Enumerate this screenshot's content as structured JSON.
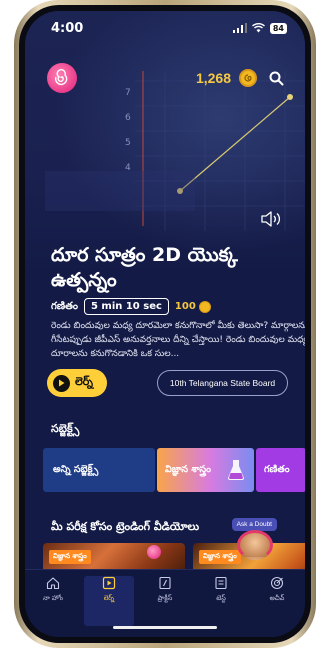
{
  "status_bar": {
    "time": "4:00",
    "battery": "84"
  },
  "header": {
    "coins": "1,268"
  },
  "video": {
    "title": "దూర సూత్రం 2D యొక్క ఉత్పన్నం",
    "subject": "గణితం",
    "duration": "5 min 10 sec",
    "coin_reward": "100",
    "description": "రెండు బిందువుల మధ్య దూరమెలా కనుగొనాలో మీకు తెలుసా? మార్గాలను గీసేటప్పుడు జీపీఎస్ అనువర్తనాలు దీన్ని చేస్తాయి! రెండు బిందువుల మధ్య దూరాలను కనుగొనడానికి ఒక సుల..."
  },
  "actions": {
    "learn_label": "లెర్న్",
    "board_label": "10th Telangana State Board"
  },
  "subjects": {
    "title": "సబ్జెక్ట్స్",
    "items": [
      {
        "label": "అన్ని సబ్జెక్ట్స్"
      },
      {
        "label": "విజ్ఞాన శాస్త్రం"
      },
      {
        "label": "గణితం"
      }
    ]
  },
  "trending": {
    "title": "మీ పరీక్ష కోసం ట్రెండింగ్ వీడియోలు",
    "ask_doubt": "Ask a Doubt",
    "videos": [
      {
        "tag": "విజ్ఞాన శాస్త్రం"
      },
      {
        "tag": "విజ్ఞాన శాస్త్రం"
      }
    ]
  },
  "chart_axis_ticks": [
    "7",
    "6",
    "5",
    "4"
  ],
  "bottom_nav": [
    {
      "label": "నా హోం",
      "icon": "home-icon"
    },
    {
      "label": "లెర్న్",
      "icon": "learn-icon",
      "active": true
    },
    {
      "label": "ప్రాక్టీస్",
      "icon": "practice-icon"
    },
    {
      "label": "టెస్ట్",
      "icon": "test-icon"
    },
    {
      "label": "అచీవ్",
      "icon": "achieve-icon"
    }
  ],
  "colors": {
    "background": "#131a45",
    "accent_yellow": "#ffcf3a",
    "coin_gold": "#f5c842",
    "logo_pink": "#e0207a"
  }
}
